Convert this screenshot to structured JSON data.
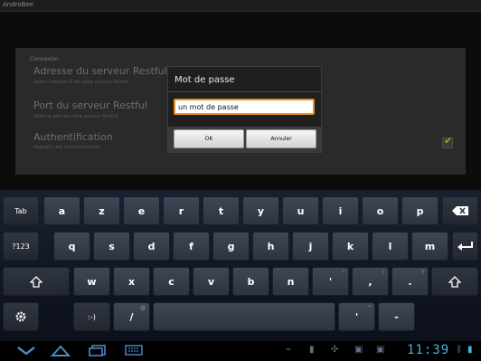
{
  "app": {
    "title": "AndroBee"
  },
  "settings": {
    "section_header": "Connexion",
    "items": [
      {
        "title": "Adresse du serveur Restful",
        "summary": "Saisir l'adresse IP de votre serveur Restful"
      },
      {
        "title": "Port du serveur Restful",
        "summary": "Saisir le port de votre serveur Restful"
      },
      {
        "title": "Authentification",
        "summary": "Requiert une authentification"
      }
    ],
    "auth_checkbox": {
      "checked": true,
      "icon": "check-icon",
      "color": "#b79d2d"
    }
  },
  "dialog": {
    "title": "Mot de passe",
    "input_value": "un mot de passe",
    "ok_label": "OK",
    "cancel_label": "Annuler",
    "focus_color": "#e58c1f"
  },
  "keyboard": {
    "rows": [
      [
        "Tab",
        "a",
        "z",
        "e",
        "r",
        "t",
        "y",
        "u",
        "i",
        "o",
        "p",
        "backspace-icon"
      ],
      [
        "?123",
        "q",
        "s",
        "d",
        "f",
        "g",
        "h",
        "j",
        "k",
        "l",
        "m",
        "enter-icon"
      ],
      [
        "shift-icon",
        "w",
        "x",
        "c",
        "v",
        "b",
        "n",
        "'",
        ",",
        ".",
        "shift-icon"
      ],
      [
        "settings-icon",
        ":-)",
        "/",
        "space",
        "'",
        "-"
      ]
    ],
    "labels": {
      "tab": "Tab",
      "a": "a",
      "z": "z",
      "e": "e",
      "r": "r",
      "t": "t",
      "y": "y",
      "u": "u",
      "i": "i",
      "o": "o",
      "p": "p",
      "mode": "?123",
      "q": "q",
      "s": "s",
      "d": "d",
      "f": "f",
      "g": "g",
      "h": "h",
      "j": "j",
      "k": "k",
      "l": "l",
      "m": "m",
      "w": "w",
      "x": "x",
      "c": "c",
      "v": "v",
      "b": "b",
      "n": "n",
      "apos": "'",
      "comma": ",",
      "period": ".",
      "smiley": ":-)",
      "slash": "/",
      "apos2": "'",
      "dash": "-"
    },
    "hints": {
      "apos": "\"",
      "comma": "!",
      "period": "?",
      "slash": "@",
      "apos2": "\""
    }
  },
  "status_bar": {
    "time": "11:39",
    "accent_color": "#41b4e6",
    "icons": [
      "back-icon",
      "home-icon",
      "recent-apps-icon",
      "keyboard-icon",
      "usb-icon",
      "usb-debug-icon",
      "android-icon",
      "image-icon",
      "download-icon",
      "bluetooth-icon",
      "battery-icon"
    ]
  }
}
